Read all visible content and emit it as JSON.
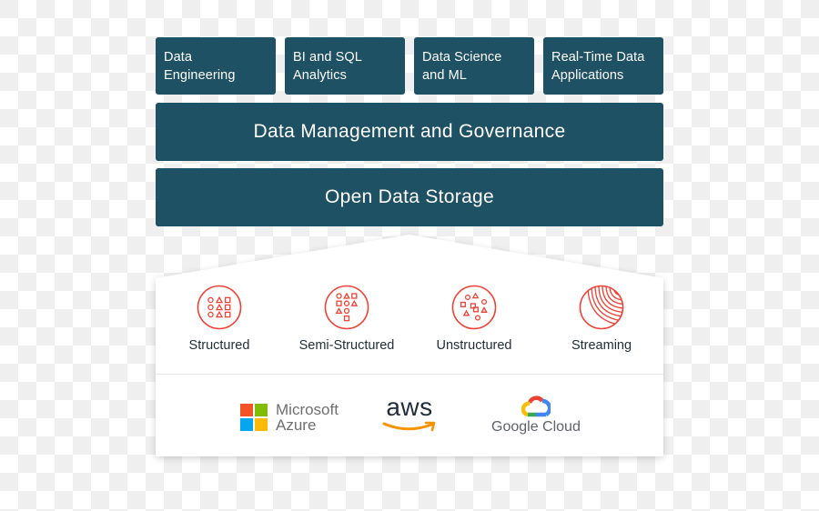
{
  "use_cases": [
    {
      "line1": "Data",
      "line2": "Engineering"
    },
    {
      "line1": "BI and SQL",
      "line2": "Analytics"
    },
    {
      "line1": "Data Science",
      "line2": "and ML"
    },
    {
      "line1": "Real-Time Data",
      "line2": "Applications"
    }
  ],
  "layers": {
    "governance": "Data Management and Governance",
    "storage": "Open Data Storage"
  },
  "data_formats": [
    {
      "label": "Structured",
      "icon": "structured-data-icon"
    },
    {
      "label": "Semi-Structured",
      "icon": "semi-structured-data-icon"
    },
    {
      "label": "Unstructured",
      "icon": "unstructured-data-icon"
    },
    {
      "label": "Streaming",
      "icon": "streaming-data-icon"
    }
  ],
  "clouds": {
    "azure": {
      "line1": "Microsoft",
      "line2": "Azure"
    },
    "aws": {
      "label": "aws"
    },
    "gcp": {
      "label": "Google Cloud"
    }
  },
  "colors": {
    "tile_bg": "#1e5163",
    "icon_accent": "#ef4135",
    "aws_orange": "#f79400",
    "ms_red": "#f35325",
    "ms_green": "#81bc06",
    "ms_blue": "#05a6f0",
    "ms_yellow": "#ffba08"
  }
}
